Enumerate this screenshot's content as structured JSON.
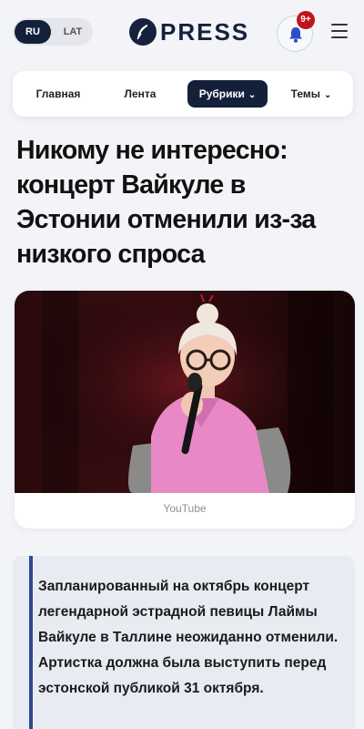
{
  "header": {
    "lang_active": "RU",
    "lang_other": "LAT",
    "logo_text": "PRESS",
    "notification_badge": "9+",
    "icons": [
      "feather-icon",
      "bell-icon",
      "menu-icon"
    ]
  },
  "nav": {
    "items": [
      {
        "label": "Главная",
        "active": false
      },
      {
        "label": "Лента",
        "active": false
      },
      {
        "label": "Рубрики",
        "active": true
      },
      {
        "label": "Темы",
        "active": false
      }
    ]
  },
  "article": {
    "headline": "Никому не интересно: концерт Вайкуле в Эстонии отменили из-за низкого спроса",
    "image_caption": "YouTube",
    "lead": "Запланированный на октябрь концерт легендарной эстрадной певицы Лаймы Вайкуле в Таллине неожиданно отменили. Артистка должна была выступить перед эстонской публикой 31 октября."
  },
  "colors": {
    "brand_dark": "#14203a",
    "badge_red": "#c0141c",
    "accent_bar": "#2e4b8f",
    "background": "#f3f4f8"
  }
}
